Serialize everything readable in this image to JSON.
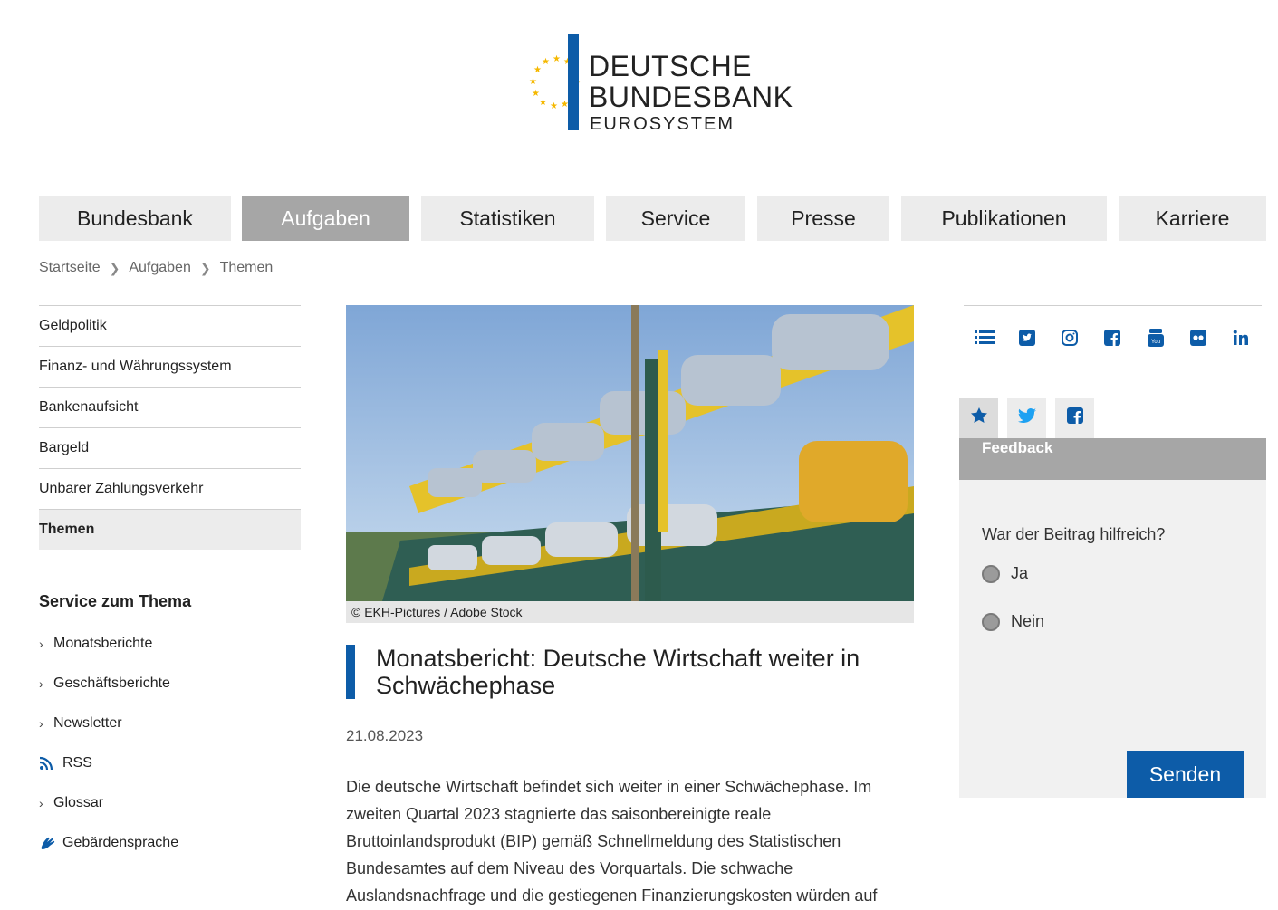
{
  "logo": {
    "line1": "DEUTSCHE",
    "line2": "BUNDESBANK",
    "line3": "EUROSYSTEM",
    "star_color": "#f5b800",
    "bar_color": "#0d5ca8"
  },
  "nav": {
    "items": [
      {
        "label": "Bundesbank",
        "active": false
      },
      {
        "label": "Aufgaben",
        "active": true
      },
      {
        "label": "Statistiken",
        "active": false
      },
      {
        "label": "Service",
        "active": false
      },
      {
        "label": "Presse",
        "active": false
      },
      {
        "label": "Publikationen",
        "active": false
      },
      {
        "label": "Karriere",
        "active": false
      }
    ]
  },
  "breadcrumb": [
    "Startseite",
    "Aufgaben",
    "Themen"
  ],
  "sidebar": {
    "items": [
      {
        "label": "Geldpolitik",
        "active": false
      },
      {
        "label": "Finanz- und Währungssystem",
        "active": false
      },
      {
        "label": "Bankenaufsicht",
        "active": false
      },
      {
        "label": "Bargeld",
        "active": false
      },
      {
        "label": "Unbarer Zahlungsverkehr",
        "active": false
      },
      {
        "label": "Themen",
        "active": true
      }
    ]
  },
  "service": {
    "heading": "Service zum Thema",
    "items": [
      {
        "label": "Monatsberichte",
        "icon": "chevron-right-icon"
      },
      {
        "label": "Geschäftsberichte",
        "icon": "chevron-right-icon"
      },
      {
        "label": "Newsletter",
        "icon": "chevron-right-icon"
      },
      {
        "label": "RSS",
        "icon": "rss-icon"
      },
      {
        "label": "Glossar",
        "icon": "chevron-right-icon"
      },
      {
        "label": "Gebärdensprache",
        "icon": "sign-language-icon"
      }
    ]
  },
  "article": {
    "image_credit": "© EKH-Pictures / Adobe Stock",
    "title": "Monatsbericht: Deutsche Wirtschaft weiter in Schwächephase",
    "date": "21.08.2023",
    "body": "Die deutsche Wirtschaft befindet sich weiter in einer Schwächephase. Im zweiten Quartal 2023 stagnierte das saisonbereinigte reale Bruttoinlandsprodukt (BIP) gemäß Schnellmeldung des Statistischen Bundesamtes auf dem Niveau des Vorquartals. Die schwache Auslandsnachfrage und die gestiegenen Finanzierungskosten würden auf"
  },
  "social": {
    "icons": [
      "list-icon",
      "twitter-icon",
      "instagram-icon",
      "facebook-icon",
      "youtube-icon",
      "flickr-icon",
      "linkedin-icon"
    ],
    "color": "#0d5ca8"
  },
  "feedback": {
    "tabs": [
      "star-icon",
      "twitter-icon",
      "facebook-icon"
    ],
    "heading": "Feedback",
    "question": "War der Beitrag hilfreich?",
    "options": [
      "Ja",
      "Nein"
    ],
    "submit_label": "Senden"
  },
  "colors": {
    "brand_blue": "#0d5ca8",
    "nav_active": "#a6a6a6",
    "nav_bg": "#ececec"
  }
}
